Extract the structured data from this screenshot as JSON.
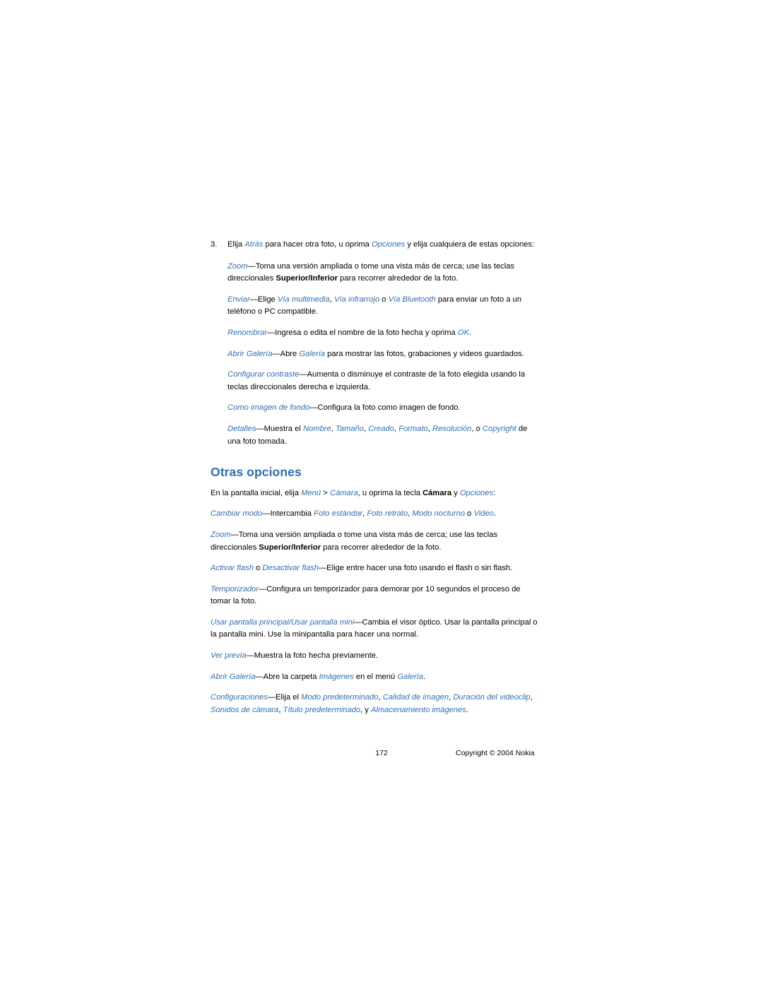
{
  "document": {
    "step3": {
      "number": "3.",
      "t1": "Elija ",
      "link1": "Atrás",
      "t2": " para hacer otra foto, u oprima ",
      "link2": "Opciones",
      "t3": " y elija cualquiera de estas opciones:"
    },
    "items": [
      {
        "id": "zoom-1",
        "lead": "Zoom",
        "rest": "—Toma una versión ampliada o tome una vista más de cerca; use las teclas direccionales ",
        "bold": "Superior/Inferior",
        "tail": " para recorrer alrededor de la foto."
      },
      {
        "id": "enviar",
        "lead": "Enviar",
        "rest": "—Elige ",
        "links": [
          "Vía multimedia",
          "Vía infrarrojo",
          "Vía Bluetooth"
        ],
        "sep1": ", ",
        "sep2": " o ",
        "tail": " para enviar un foto a un teléfono o PC compatible."
      },
      {
        "id": "renombrar",
        "lead": "Renombrar",
        "rest": "—Ingresa o edita el nombre de la foto hecha y oprima ",
        "link": "OK",
        "tail": "."
      },
      {
        "id": "abrir-galeria-1",
        "lead": "Abrir Galería",
        "rest": "—Abre ",
        "link": "Galería",
        "tail": " para mostrar las fotos, grabaciones y videos guardados."
      },
      {
        "id": "configurar-contraste",
        "lead": "Configurar contraste",
        "rest": "—Aumenta o disminuye el contraste de la foto elegida usando la teclas direccionales derecha e izquierda."
      },
      {
        "id": "como-imagen-de-fondo",
        "lead": "Como imagen de fondo",
        "rest": "—Configura la foto como imagen de fondo."
      },
      {
        "id": "detalles",
        "lead": "Detalles",
        "rest": "—Muestra el ",
        "links": [
          "Nombre",
          "Tamaño",
          "Creado",
          "Formato",
          "Resolución",
          "Copyright"
        ],
        "tail": " de una foto tomada."
      }
    ],
    "section_title": "Otras opciones",
    "intro": {
      "t1": "En la pantalla inicial, elija ",
      "link1": "Menú",
      "t2": " > ",
      "link2": "Cámara",
      "t3": ", u oprima la tecla ",
      "bold": "Cámara",
      "t4": " y ",
      "link3": "Opciones",
      "t5": ":"
    },
    "items2": [
      {
        "id": "cambiar-modo",
        "lead": "Cambiar modo",
        "rest": "—Intercambia ",
        "links": [
          "Foto estándar",
          "Foto retrato",
          "Modo nocturno",
          "Video"
        ],
        "tail": "."
      },
      {
        "id": "zoom-2",
        "lead": "Zoom",
        "rest": "—Toma una versión ampliada o tome una vista más de cerca; use las teclas direccionales ",
        "bold": "Superior/Inferior",
        "tail": " para recorrer alrededor de la foto."
      },
      {
        "id": "activar-flash",
        "lead": "Activar flash",
        "mid": " o ",
        "lead2": "Desactivar flash",
        "rest": "—Elige entre hacer una foto usando el flash o sin flash."
      },
      {
        "id": "temporizador",
        "lead": "Temporizador",
        "rest": "—Configura un temporizador para demorar por 10 segundos el proceso de tomar la foto."
      },
      {
        "id": "usar-pantalla",
        "lead": "Usar pantalla principal",
        "mid": "/",
        "lead2": "Usar pantalla mini",
        "rest": "—Cambia el visor óptico. Usar la pantalla principal o la pantalla mini. Use la minipantalla para hacer una normal."
      },
      {
        "id": "ver-previa",
        "lead": "Ver previa",
        "rest": "—Muestra la foto hecha previamente."
      },
      {
        "id": "abrir-galeria-2",
        "lead": "Abrir Galería",
        "rest": "—Abre la carpeta ",
        "link": "Imágenes",
        "mid": " en el menú ",
        "link2": "Galería",
        "tail": "."
      },
      {
        "id": "configuraciones",
        "lead": "Configuraciones",
        "rest": "—Elija el ",
        "links": [
          "Modo predeterminado",
          "Calidad de imagen",
          "Duración del videoclip",
          "Sonidos de cámara",
          "Título predeterminado",
          "Almacenamiento imágenes"
        ],
        "tail": "."
      }
    ],
    "footer": {
      "page_number": "172",
      "copyright": "Copyright © 2004 Nokia"
    }
  }
}
